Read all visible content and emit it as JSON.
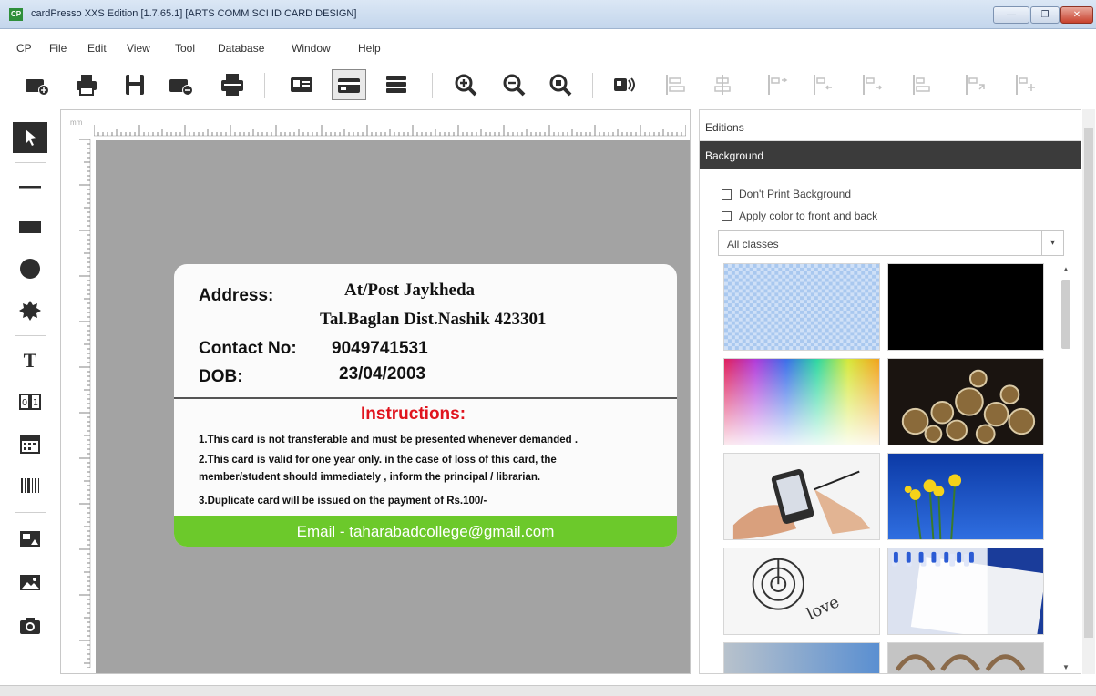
{
  "window": {
    "app_icon": "CP",
    "title": "cardPresso XXS Edition [1.7.65.1] [ARTS COMM SCI ID CARD DESIGN]",
    "controls": {
      "minimize": "—",
      "maximize": "❐",
      "close": "✕"
    }
  },
  "menu": {
    "items": [
      "CP",
      "File",
      "Edit",
      "View",
      "Tool",
      "Database",
      "Window",
      "Help"
    ]
  },
  "toolbar": {
    "buttons": [
      "new-card-icon",
      "print-icon",
      "save-icon",
      "open-icon",
      "printer-icon",
      "card-front-icon",
      "card-back-icon",
      "card-list-icon",
      "zoom-in-icon",
      "zoom-out-icon",
      "zoom-fit-icon",
      "encode-icon",
      "align-left-icon",
      "align-center-icon",
      "align-right-icon",
      "align-top-icon",
      "align-middle-icon",
      "align-bottom-icon",
      "distribute-h-icon",
      "distribute-v-icon"
    ]
  },
  "tools": {
    "items": [
      "select-icon",
      "line-icon",
      "rectangle-icon",
      "ellipse-icon",
      "star-icon",
      "text-icon",
      "counter-icon",
      "date-icon",
      "barcode-icon",
      "photo-field-icon",
      "image-icon",
      "camera-icon"
    ]
  },
  "ruler": {
    "unit": "mm"
  },
  "card": {
    "address_label": "Address:",
    "address_line1": "At/Post Jaykheda",
    "address_line2": "Tal.Baglan Dist.Nashik 423301",
    "contact_label": "Contact No:",
    "contact_value": "9049741531",
    "dob_label": "DOB:",
    "dob_value": "23/04/2003",
    "instructions_title": "Instructions:",
    "instructions": [
      "1.This card is not transferable and must be presented whenever demanded .",
      "2.This card is valid for one year only. in the case of loss of this card, the",
      "member/student should immediately , inform the principal / librarian.",
      "3.Duplicate card will be issued on the payment of     Rs.100/-"
    ],
    "email": "Email - taharabadcollege@gmail.com",
    "colors": {
      "email_band": "#6cc92b",
      "instructions_title": "#e0141e"
    }
  },
  "panel": {
    "editions_label": "Editions",
    "background_label": "Background",
    "dont_print_label": "Don't Print Background",
    "apply_color_label": "Apply color to front and back",
    "class_select": {
      "value": "All classes",
      "arrow": "▾"
    },
    "thumbnails": [
      "transparent-checker",
      "black",
      "color-spectrum",
      "clocks",
      "hand-smartphone",
      "yellow-flowers-blue-sky",
      "love-target",
      "calendar-page",
      "sky-partial",
      "binder-partial"
    ],
    "thumb_caption_love": "love"
  }
}
